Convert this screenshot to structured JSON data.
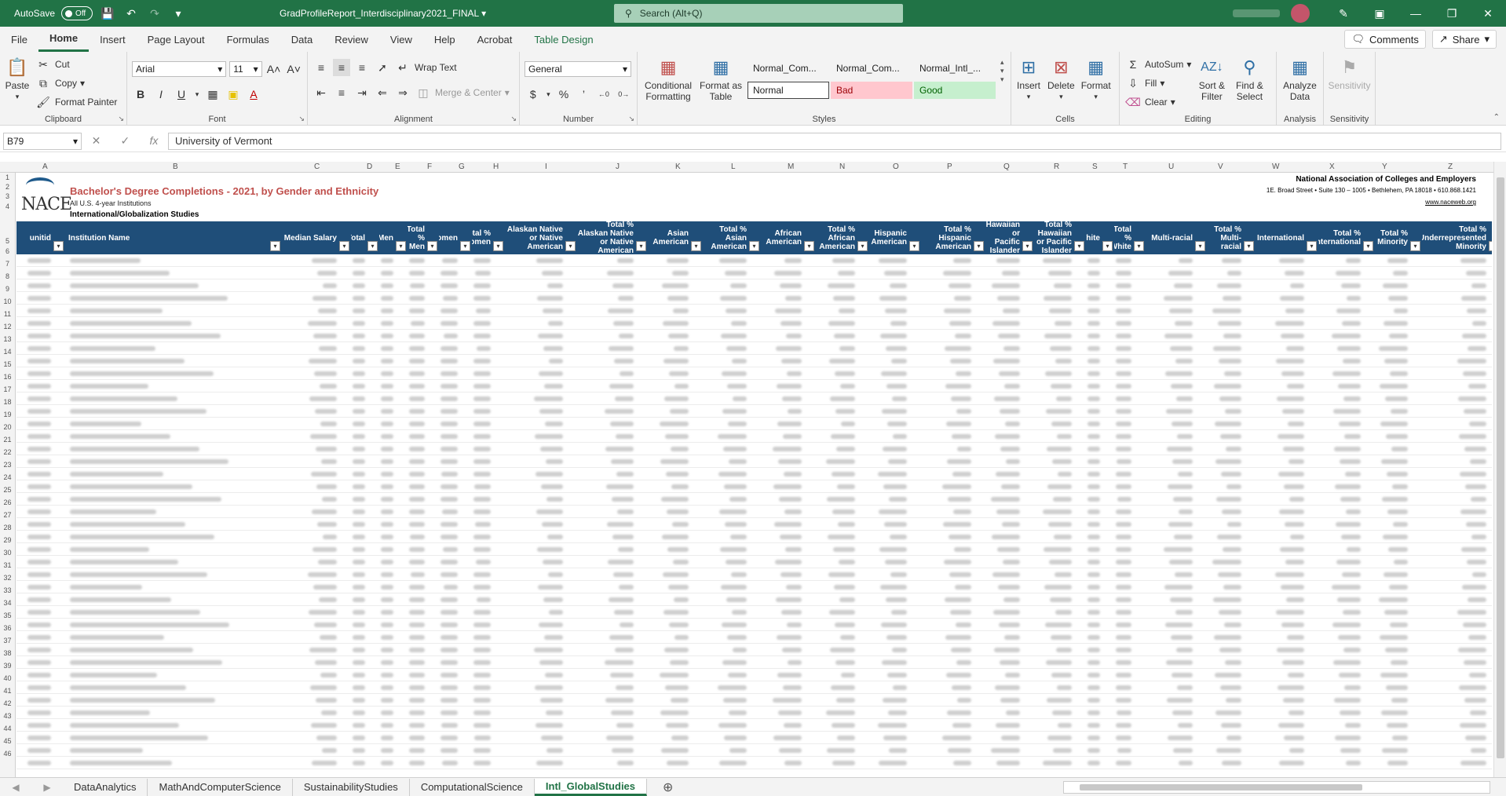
{
  "titlebar": {
    "autosave_label": "AutoSave",
    "autosave_state": "Off",
    "doc_title": "GradProfileReport_Interdisciplinary2021_FINAL",
    "search_placeholder": "Search (Alt+Q)"
  },
  "menu": {
    "tabs": [
      "File",
      "Home",
      "Insert",
      "Page Layout",
      "Formulas",
      "Data",
      "Review",
      "View",
      "Help",
      "Acrobat",
      "Table Design"
    ],
    "active": "Home",
    "comments": "Comments",
    "share": "Share"
  },
  "ribbon": {
    "clipboard": {
      "label": "Clipboard",
      "paste": "Paste",
      "cut": "Cut",
      "copy": "Copy",
      "format_painter": "Format Painter"
    },
    "font": {
      "label": "Font",
      "name": "Arial",
      "size": "11"
    },
    "alignment": {
      "label": "Alignment",
      "wrap": "Wrap Text",
      "merge": "Merge & Center"
    },
    "number": {
      "label": "Number",
      "format": "General"
    },
    "styles": {
      "label": "Styles",
      "conditional": "Conditional Formatting",
      "format_table": "Format as Table",
      "cells": [
        "Normal_Com...",
        "Normal_Com...",
        "Normal_Intl_...",
        "Normal",
        "Bad",
        "Good"
      ]
    },
    "cells": {
      "label": "Cells",
      "insert": "Insert",
      "delete": "Delete",
      "format": "Format"
    },
    "editing": {
      "label": "Editing",
      "autosum": "AutoSum",
      "fill": "Fill",
      "clear": "Clear",
      "sort": "Sort & Filter",
      "find": "Find & Select"
    },
    "analysis": {
      "label": "Analysis",
      "analyze": "Analyze Data"
    },
    "sensitivity": {
      "label": "Sensitivity",
      "btn": "Sensitivity"
    }
  },
  "formula": {
    "namebox": "B79",
    "content": "University of Vermont"
  },
  "columns": [
    "A",
    "B",
    "C",
    "D",
    "E",
    "F",
    "G",
    "H",
    "I",
    "J",
    "K",
    "L",
    "M",
    "N",
    "O",
    "P",
    "Q",
    "R",
    "S",
    "T",
    "U",
    "V",
    "W",
    "X",
    "Y",
    "Z"
  ],
  "rows": [
    "1",
    "2",
    "3",
    "4",
    "5",
    "6",
    "7",
    "8",
    "9",
    "10",
    "11",
    "12",
    "13",
    "14",
    "15",
    "16",
    "17",
    "18",
    "19",
    "20",
    "21",
    "22",
    "23",
    "24",
    "25",
    "26",
    "27",
    "28",
    "29",
    "30",
    "31",
    "32",
    "33",
    "34",
    "35",
    "36",
    "37",
    "38",
    "39",
    "40",
    "41",
    "42",
    "43",
    "44",
    "45",
    "46"
  ],
  "report": {
    "title": "Bachelor's Degree Completions - 2021, by Gender and Ethnicity",
    "subtitle": "All U.S. 4-year Institutions",
    "program": "International/Globalization Studies",
    "logo": "NACE",
    "org_name": "National Association of Colleges and Employers",
    "org_address": "1E. Broad Street • Suite 130 – 1005 • Bethlehem, PA 18018 • 610.868.1421",
    "org_web": "www.naceweb.org"
  },
  "table_headers": [
    "unitid",
    "Institution Name",
    "Median Salary",
    "Total",
    "Men",
    "Total % Men",
    "Women",
    "Total % Women",
    "Alaskan Native or Native American",
    "Total % Alaskan Native or Native American",
    "Asian American",
    "Total % Asian American",
    "African American",
    "Total % African American",
    "Hispanic American",
    "Total % Hispanic American",
    "Hawaiian or Pacific Islander",
    "Total % Hawaiian or Pacific Islander",
    "White",
    "Total % White",
    "Multi-racial",
    "Total % Multi-racial",
    "International",
    "Total % International",
    "Total % Minority",
    "Total % Underrepresented Minority"
  ],
  "sheets": [
    "DataAnalytics",
    "MathAndComputerScience",
    "SustainabilityStudies",
    "ComputationalScience",
    "Intl_GlobalStudies"
  ],
  "active_sheet": "Intl_GlobalStudies"
}
